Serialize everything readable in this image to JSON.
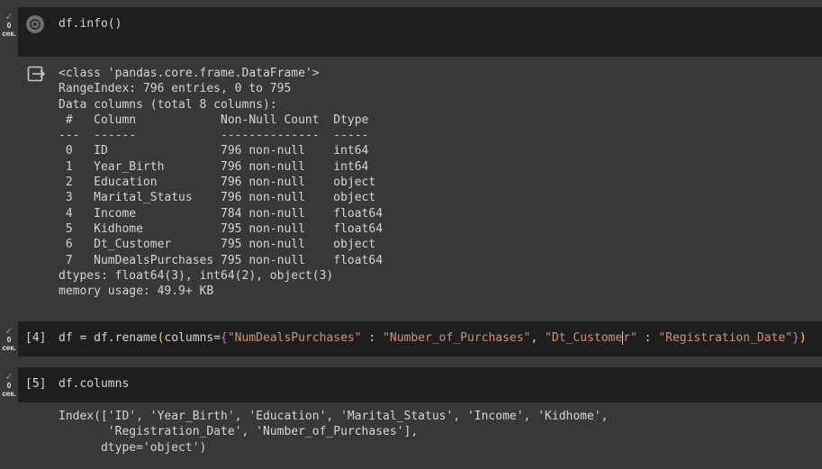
{
  "cells": [
    {
      "status": {
        "check": "✓",
        "seconds": "0",
        "unit": "сек."
      },
      "run_button_icon": "play-icon",
      "code": "df.info()",
      "output_icon": "output-redirect-icon",
      "output_lines": [
        "<class 'pandas.core.frame.DataFrame'>",
        "RangeIndex: 796 entries, 0 to 795",
        "Data columns (total 8 columns):",
        " #   Column            Non-Null Count  Dtype  ",
        "---  ------            --------------  -----  ",
        " 0   ID                796 non-null    int64  ",
        " 1   Year_Birth        796 non-null    int64  ",
        " 2   Education         796 non-null    object ",
        " 3   Marital_Status    796 non-null    object ",
        " 4   Income            784 non-null    float64",
        " 5   Kidhome           795 non-null    float64",
        " 6   Dt_Customer       795 non-null    object ",
        " 7   NumDealsPurchases 795 non-null    float64",
        "dtypes: float64(3), int64(2), object(3)",
        "memory usage: 49.9+ KB"
      ]
    },
    {
      "status": {
        "check": "✓",
        "seconds": "0",
        "unit": "сек."
      },
      "exec_count": "[4]",
      "code_parts": {
        "prefix": "df = df.rename",
        "open_paren": "(",
        "kw": "columns=",
        "open_brace": "{",
        "s1": "\"NumDealsPurchases\"",
        "colon1": " : ",
        "s2": "\"Number_of_Purchases\"",
        "comma": ", ",
        "s3a": "\"Dt_Custome",
        "s3b": "r\"",
        "colon2": " : ",
        "s4": "\"Registration_Date\"",
        "close_brace": "}",
        "close_paren": ")"
      }
    },
    {
      "status": {
        "check": "✓",
        "seconds": "0",
        "unit": "сек."
      },
      "exec_count": "[5]",
      "code": "df.columns",
      "output_lines": [
        "Index(['ID', 'Year_Birth', 'Education', 'Marital_Status', 'Income', 'Kidhome',",
        "       'Registration_Date', 'Number_of_Purchases'],",
        "      dtype='object')"
      ]
    }
  ]
}
